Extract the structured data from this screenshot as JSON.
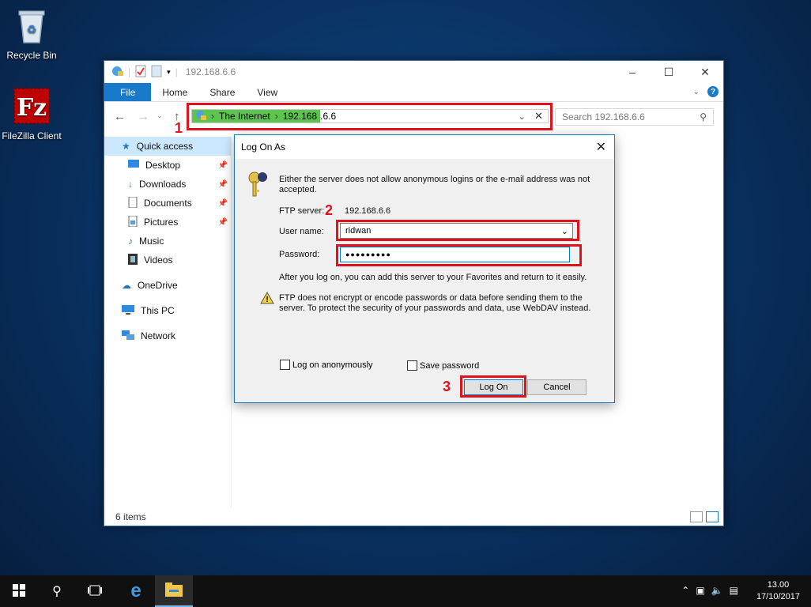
{
  "desktop": {
    "recycle_bin": "Recycle Bin",
    "filezilla": "FileZilla Client"
  },
  "explorer": {
    "title": "192.168.6.6",
    "tabs": [
      "File",
      "Home",
      "Share",
      "View"
    ],
    "address": {
      "segment1": "The Internet",
      "segment2_hl": "192.168",
      "segment2_rest": ".6.6"
    },
    "search_placeholder": "Search 192.168.6.6",
    "sidebar": [
      {
        "label": "Quick access",
        "icon": "star-icon"
      },
      {
        "label": "Desktop",
        "icon": "desktop-icon"
      },
      {
        "label": "Downloads",
        "icon": "download-icon"
      },
      {
        "label": "Documents",
        "icon": "documents-icon"
      },
      {
        "label": "Pictures",
        "icon": "pictures-icon"
      },
      {
        "label": "Music",
        "icon": "music-icon"
      },
      {
        "label": "Videos",
        "icon": "videos-icon"
      },
      {
        "label": "OneDrive",
        "icon": "cloud-icon"
      },
      {
        "label": "This PC",
        "icon": "computer-icon"
      },
      {
        "label": "Network",
        "icon": "network-icon"
      }
    ],
    "status": "6 items"
  },
  "dialog": {
    "title": "Log On As",
    "message": "Either the server does not allow anonymous logins or the e-mail address was not accepted.",
    "ftp_server_label": "FTP server:",
    "ftp_server_value": "192.168.6.6",
    "username_label": "User name:",
    "username_value": "ridwan",
    "password_label": "Password:",
    "password_value": "●●●●●●●●●",
    "info": "After you log on, you can add this server to your Favorites and return to it easily.",
    "warning": "FTP does not encrypt or encode passwords or data before sending them to the server.  To protect the security of your passwords and data, use WebDAV instead.",
    "anon_label": "Log on anonymously",
    "save_label": "Save password",
    "logon_button": "Log On",
    "cancel_button": "Cancel"
  },
  "annotations": {
    "n1": "1",
    "n2": "2",
    "n3": "3",
    "color": "#e0131c"
  },
  "taskbar": {
    "time": "13.00",
    "date": "17/10/2017"
  }
}
